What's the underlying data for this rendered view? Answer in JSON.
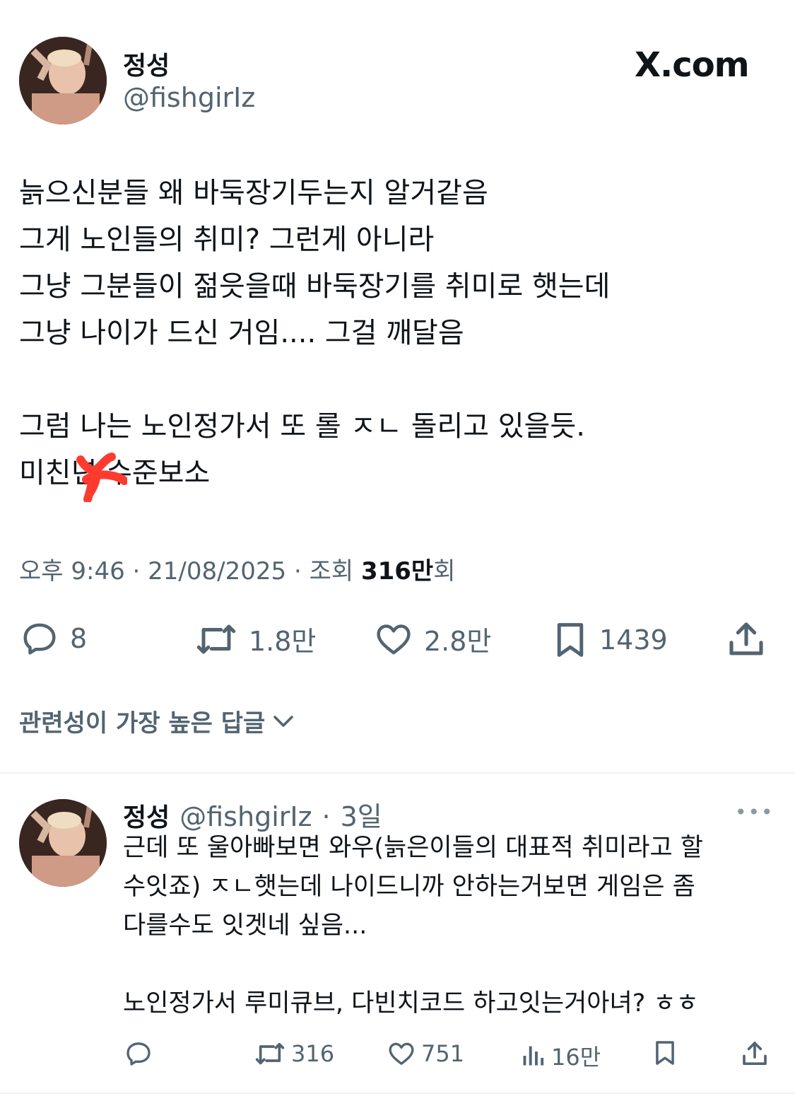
{
  "post": {
    "display_name": "정성",
    "handle": "@fishgirIz",
    "brand": "X.com",
    "body": "늙으신분들 왜 바둑장기두는지 알거같음\n그게 노인들의 취미? 그런게 아니라\n그냥 그분들이 젊읏을때 바둑장기를 취미로 햇는데\n그냥 나이가 드신 거임.... 그걸 깨달음\n\n그럼 나는 노인정가서 또 롤 ㅈㄴ 돌리고 있을듯.\n미친년 수준보소",
    "time": "오후 9:46",
    "date": "21/08/2025",
    "views_label": "조회",
    "views_value": "316만",
    "views_suffix": "회",
    "replies": "8",
    "reposts": "1.8만",
    "likes": "2.8만",
    "bookmarks": "1439"
  },
  "sort": {
    "label": "관련성이 가장 높은 답글"
  },
  "reply": {
    "display_name": "정성",
    "handle": "@fishgirIz",
    "age": "3일",
    "more": "•••",
    "body": "근데 또 울아빠보면 와우(늙은이들의 대표적 취미라고 할\n수잇죠) ㅈㄴ햇는데 나이드니까 안하는거보면 게임은 좀\n다를수도 잇겟네 싶음...\n\n노인정가서 루미큐브, 다빈치코드 하고잇는거아녀? ㅎㅎ",
    "reposts": "316",
    "likes": "751",
    "views": "16만"
  },
  "colors": {
    "text": "#0f1419",
    "muted": "#536471",
    "divider": "#eff3f4",
    "censor": "#ff3b2f"
  },
  "icons": [
    "comment-icon",
    "repost-icon",
    "heart-icon",
    "bookmark-icon",
    "share-icon",
    "chevron-down-icon",
    "analytics-icon"
  ]
}
